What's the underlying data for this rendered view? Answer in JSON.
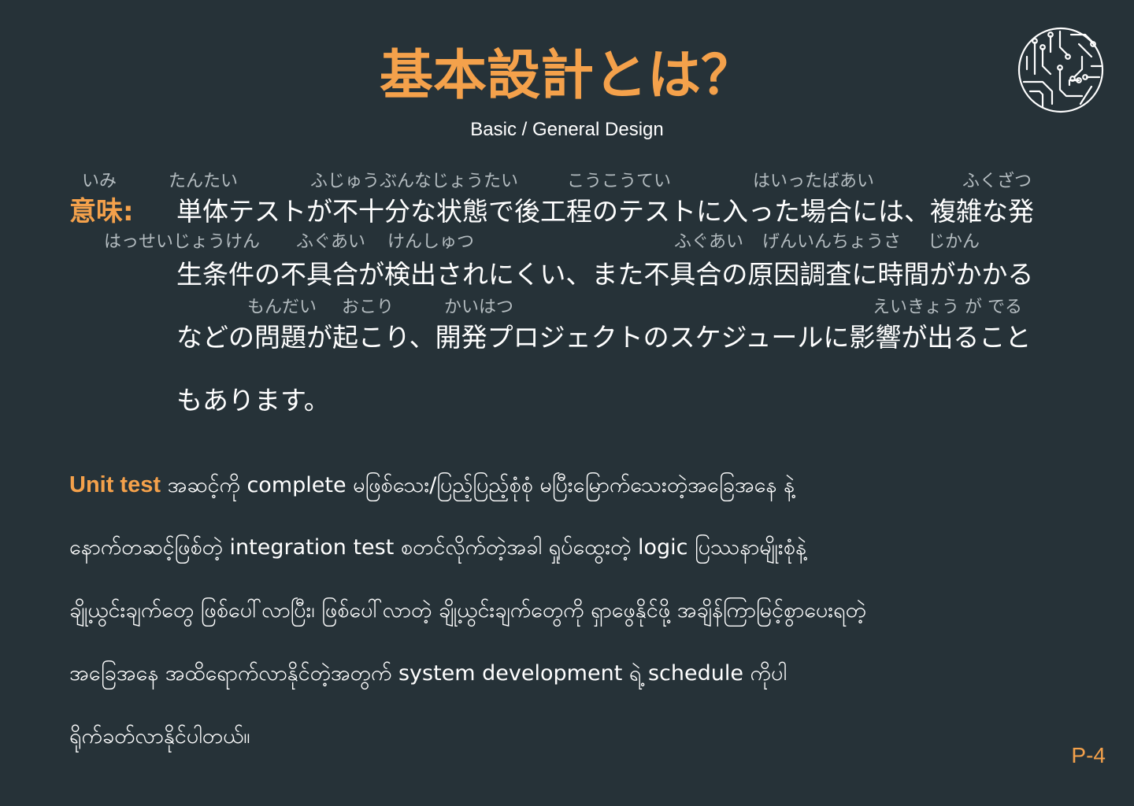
{
  "title": "基本設計とは？",
  "subtitle": "Basic / General Design",
  "meaning": {
    "label": "意味:",
    "ruby_rows": [
      [
        "いみ",
        "たんたい",
        "ふじゅうぶんなじょうたい",
        "こうこうてい",
        "はいったばあい",
        "ふくざつ"
      ],
      [
        "はっせいじょうけん",
        "ふぐあい",
        "けんしゅつ",
        "ふぐあい",
        "げんいんちょうさ",
        "じかん"
      ],
      [
        "もんだい",
        "おこり",
        "かいはつ",
        "えいきょう が でる"
      ]
    ],
    "lines": [
      "単体テストが不十分な状態で後工程のテストに入った場合には、複雑な発",
      "生条件の不具合が検出されにくい、また不具合の原因調査に時間がかかる",
      "などの問題が起こり、開発プロジェクトのスケジュールに影響が出ること",
      "もあります。"
    ]
  },
  "myanmar": {
    "highlight": "Unit test",
    "lines": [
      " အဆင့်ကို complete မဖြစ်သေး/ပြည့်ပြည့်စုံစုံ မပြီးမြောက်သေးတဲ့အခြေအနေ နဲ့",
      "နောက်တဆင့်ဖြစ်တဲ့ integration test စတင်လိုက်တဲ့အခါ ရှုပ်ထွေးတဲ့ logic ပြဿနာမျိုးစုံနဲ့",
      "ချို့ယွင်းချက်တွေ ဖြစ်ပေါ်လာပြီး၊ ဖြစ်ပေါ်လာတဲ့ ချို့ယွင်းချက်တွေကို ရှာဖွေနိုင်ဖို့ အချိန်ကြာမြင့်စွာပေးရတဲ့",
      "အခြေအနေ အထိရောက်လာနိုင်တဲ့အတွက် system development ရဲ့ schedule ကိုပါ",
      "ရိုက်ခတ်လာနိုင်ပါတယ်။"
    ]
  },
  "page_number": "P-4",
  "colors": {
    "background": "#263238",
    "accent": "#f4a14b",
    "text": "#ffffff",
    "ruby": "#b4bcc0"
  }
}
